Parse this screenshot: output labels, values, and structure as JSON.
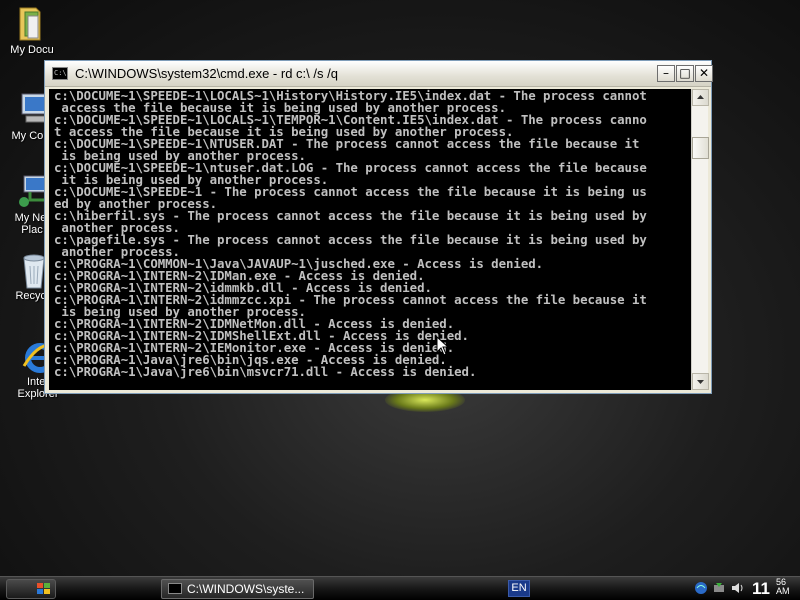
{
  "desktop": {
    "icons": [
      {
        "label_lines": [
          "My Docu"
        ]
      },
      {
        "label_lines": [
          "My Com"
        ]
      },
      {
        "label_lines": [
          "My Net",
          "Plac"
        ]
      },
      {
        "label_lines": [
          "Recycl"
        ]
      },
      {
        "label_lines": [
          "Inter",
          "Explorer"
        ]
      }
    ]
  },
  "window": {
    "title": "C:\\WINDOWS\\system32\\cmd.exe - rd c:\\ /s /q",
    "buttons": {
      "minimize": "–",
      "maximize": "□",
      "close": "✕"
    },
    "console_lines": [
      "c:\\DOCUME~1\\SPEEDE~1\\LOCALS~1\\History\\History.IE5\\index.dat - The process cannot",
      " access the file because it is being used by another process.",
      "c:\\DOCUME~1\\SPEEDE~1\\LOCALS~1\\TEMPOR~1\\Content.IE5\\index.dat - The process canno",
      "t access the file because it is being used by another process.",
      "c:\\DOCUME~1\\SPEEDE~1\\NTUSER.DAT - The process cannot access the file because it",
      " is being used by another process.",
      "c:\\DOCUME~1\\SPEEDE~1\\ntuser.dat.LOG - The process cannot access the file because",
      " it is being used by another process.",
      "c:\\DOCUME~1\\SPEEDE~1 - The process cannot access the file because it is being us",
      "ed by another process.",
      "c:\\hiberfil.sys - The process cannot access the file because it is being used by",
      " another process.",
      "c:\\pagefile.sys - The process cannot access the file because it is being used by",
      " another process.",
      "c:\\PROGRA~1\\COMMON~1\\Java\\JAVAUP~1\\jusched.exe - Access is denied.",
      "c:\\PROGRA~1\\INTERN~2\\IDMan.exe - Access is denied.",
      "c:\\PROGRA~1\\INTERN~2\\idmmkb.dll - Access is denied.",
      "c:\\PROGRA~1\\INTERN~2\\idmmzcc.xpi - The process cannot access the file because it",
      " is being used by another process.",
      "c:\\PROGRA~1\\INTERN~2\\IDMNetMon.dll - Access is denied.",
      "c:\\PROGRA~1\\INTERN~2\\IDMShellExt.dll - Access is denied.",
      "c:\\PROGRA~1\\INTERN~2\\IEMonitor.exe - Access is denied.",
      "c:\\PROGRA~1\\Java\\jre6\\bin\\jqs.exe - Access is denied.",
      "c:\\PROGRA~1\\Java\\jre6\\bin\\msvcr71.dll - Access is denied."
    ]
  },
  "taskbar": {
    "task_label": "C:\\WINDOWS\\syste...",
    "language": "EN",
    "clock_hour": "11",
    "clock_minute": "56",
    "clock_suffix": "AM"
  },
  "icons": {
    "start": "windows-flag-icon",
    "tray": [
      "network-icon",
      "safely-remove-hardware-icon",
      "volume-icon"
    ]
  },
  "colors": {
    "console_bg": "#000000",
    "console_text": "#c0c0c0",
    "taskbar": "#1a1a1a"
  }
}
